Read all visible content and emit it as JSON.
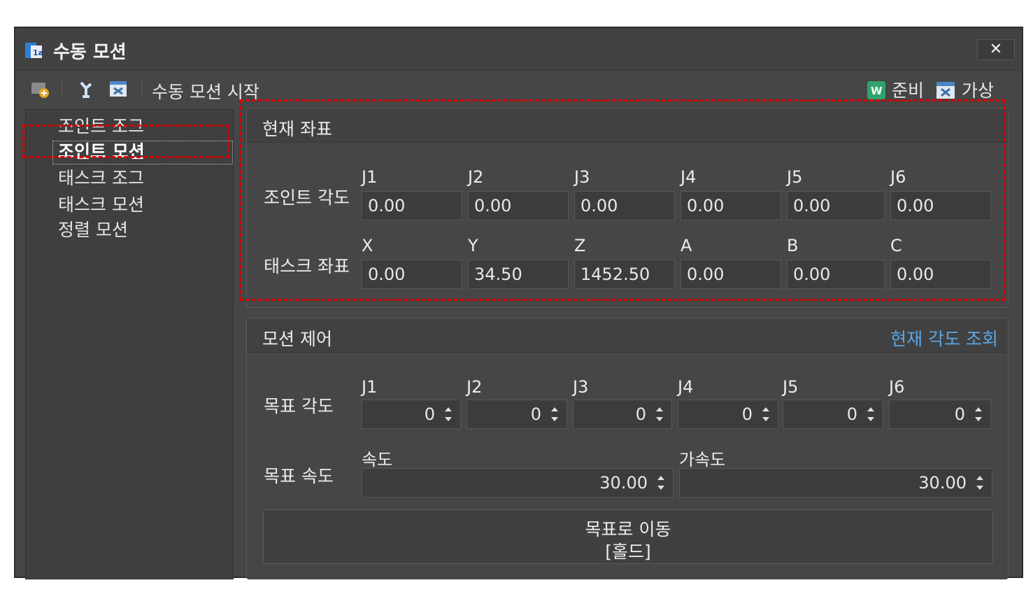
{
  "window": {
    "title": "수동 모션"
  },
  "toolbar": {
    "start_label": "수동 모션 시작",
    "ready_label": "준비",
    "virtual_label": "가상"
  },
  "sidebar": {
    "items": [
      {
        "label": "조인트 조그"
      },
      {
        "label": "조인트 모션"
      },
      {
        "label": "태스크 조그"
      },
      {
        "label": "태스크 모션"
      },
      {
        "label": "정렬 모션"
      }
    ],
    "selected_index": 1
  },
  "current_coords": {
    "title": "현재 좌표",
    "joint_row_label": "조인트 각도",
    "joint_cols": [
      "J1",
      "J2",
      "J3",
      "J4",
      "J5",
      "J6"
    ],
    "joint_values": [
      "0.00",
      "0.00",
      "0.00",
      "0.00",
      "0.00",
      "0.00"
    ],
    "task_row_label": "태스크 좌표",
    "task_cols": [
      "X",
      "Y",
      "Z",
      "A",
      "B",
      "C"
    ],
    "task_values": [
      "0.00",
      "34.50",
      "1452.50",
      "0.00",
      "0.00",
      "0.00"
    ]
  },
  "motion_control": {
    "title": "모션 제어",
    "query_link": "현재 각도 조회",
    "target_angle_label": "목표 각도",
    "angle_cols": [
      "J1",
      "J2",
      "J3",
      "J4",
      "J5",
      "J6"
    ],
    "angle_values": [
      "0",
      "0",
      "0",
      "0",
      "0",
      "0"
    ],
    "target_speed_label": "목표 속도",
    "speed_label": "속도",
    "speed_value": "30.00",
    "accel_label": "가속도",
    "accel_value": "30.00",
    "move_button_line1": "목표로 이동",
    "move_button_line2": "[홀드]"
  },
  "colors": {
    "accent_link": "#5aa6e8",
    "highlight_dash": "#d40000"
  }
}
